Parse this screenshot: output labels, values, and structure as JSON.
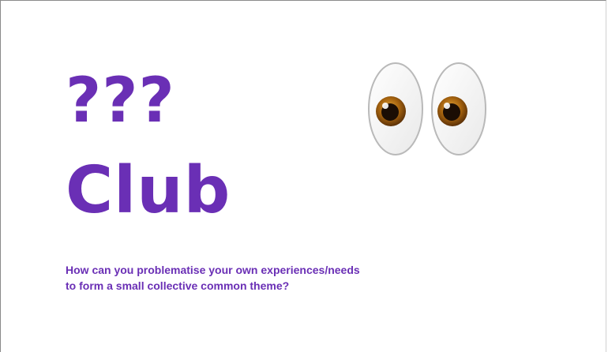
{
  "slide": {
    "title_line1": "???",
    "title_line2": "Club",
    "question": "How can you problematise your own experiences/needs to form a small collective common theme?",
    "eyes_icon": "eyes-emoji-icon",
    "accent_color": "#6a2fb5"
  }
}
